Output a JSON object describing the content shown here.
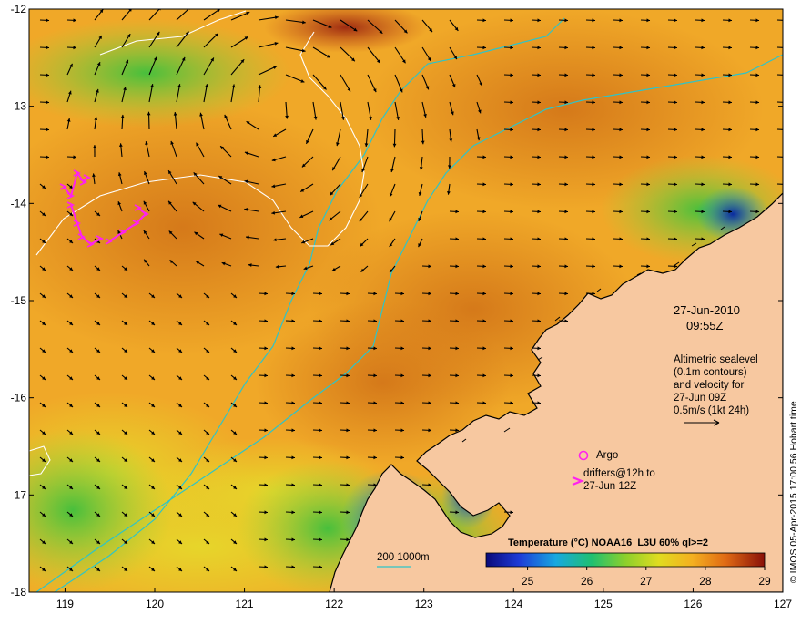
{
  "map": {
    "lon_ticks": [
      "119",
      "120",
      "121",
      "122",
      "123",
      "124",
      "125",
      "126",
      "127"
    ],
    "lat_ticks": [
      "-12",
      "-13",
      "-14",
      "-15",
      "-16",
      "-17",
      "-18"
    ],
    "lon_range": [
      118.6,
      127.0
    ],
    "lat_range": [
      -12.0,
      -18.0
    ]
  },
  "annotations": {
    "date": "27-Jun-2010",
    "time": "09:55Z",
    "altimetry_lines": [
      "Altimetric sealevel",
      "(0.1m contours)",
      "and velocity for",
      "27-Jun 09Z",
      "0.5m/s (1kt 24h)"
    ],
    "argo_label": "Argo",
    "drifter_lines": [
      "drifters@12h to",
      "27-Jun 12Z"
    ],
    "bathy_legend": "200  1000m",
    "credit": "© IMOS 05-Apr-2015 17:00:56 Hobart time"
  },
  "colorbar": {
    "title": "Temperature (°C) NOAA16_L3U 60% ql>=2",
    "ticks": [
      "25",
      "26",
      "27",
      "28",
      "29"
    ],
    "range": [
      24.3,
      29.0
    ]
  },
  "colors": {
    "land": "#f7c8a0",
    "sst_warm": "#e88a1c",
    "sst_mid": "#f0a828",
    "sst_cool": "#3cb850",
    "drifter": "#ff22ee",
    "bathy": "#2ec4c8",
    "contour": "#ffffff"
  }
}
